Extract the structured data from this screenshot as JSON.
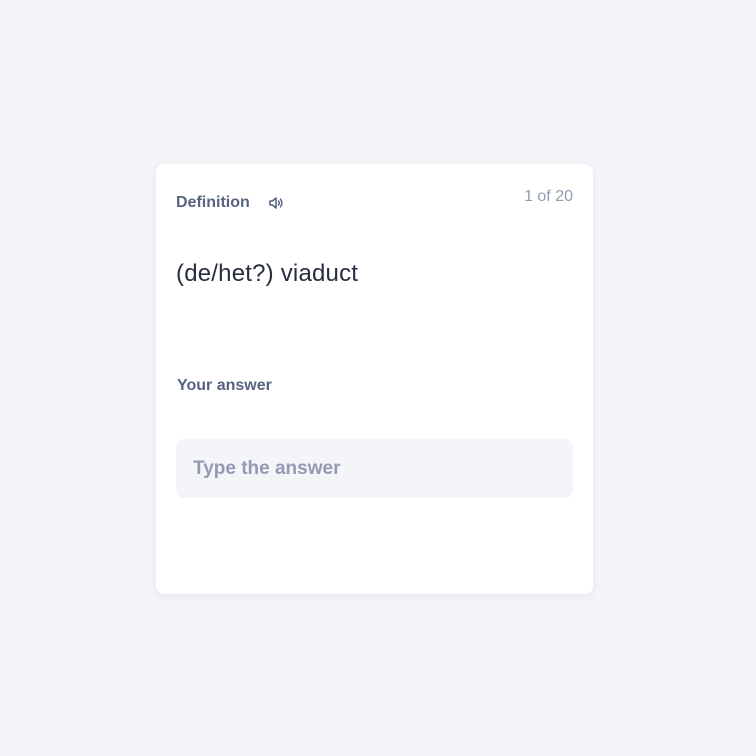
{
  "card": {
    "section_label": "Definition",
    "counter": "1 of 20",
    "term": "(de/het?) viaduct",
    "answer_label": "Your answer",
    "answer_value": "",
    "answer_placeholder": "Type the answer"
  },
  "icons": {
    "audio": "speaker-icon"
  },
  "colors": {
    "background": "#f4f5f9",
    "card": "#ffffff",
    "label": "#586380",
    "muted": "#939bb4",
    "text": "#282e3e"
  }
}
